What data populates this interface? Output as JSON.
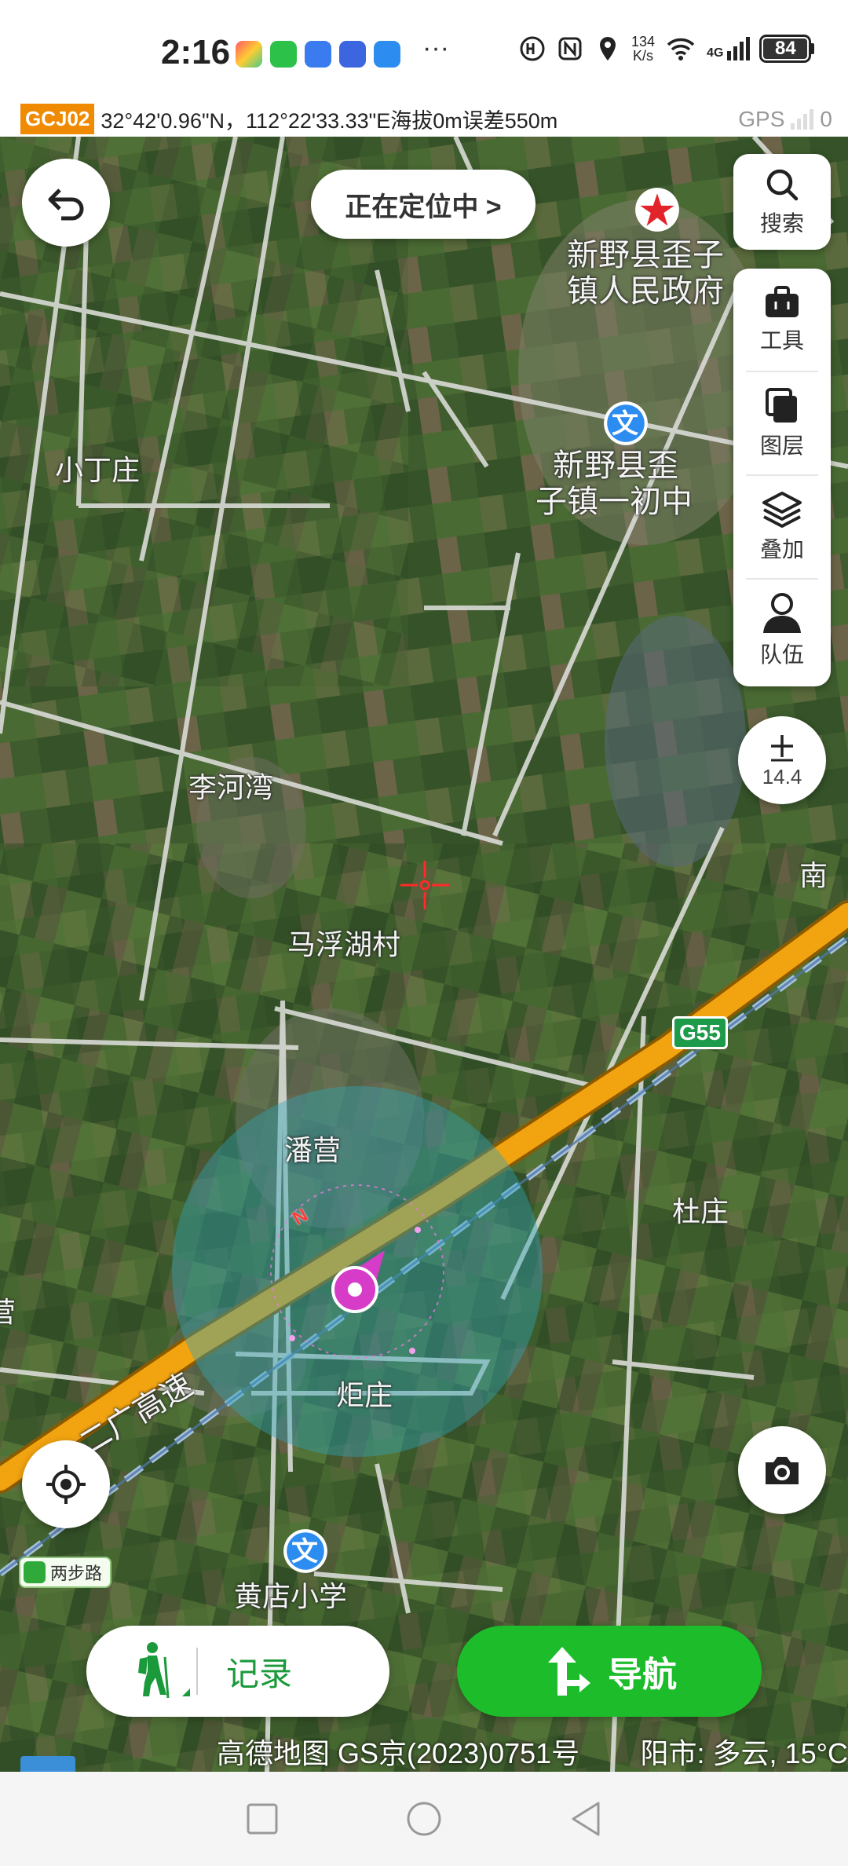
{
  "status_bar": {
    "time": "2:16",
    "more": "···",
    "net_speed_value": "134",
    "net_speed_unit": "K/s",
    "network": "4G",
    "battery": "84"
  },
  "coord_bar": {
    "crs": "GCJ02",
    "coords": "32°42'0.96\"N，112°22'33.33\"E海拔0m误差550m",
    "gps_label": "GPS",
    "gps_count": "0"
  },
  "map": {
    "labels": {
      "gov": "新野县歪子镇人民政府",
      "gov_line1": "新野县歪子",
      "gov_line2": "镇人民政府",
      "school1_line1": "新野县歪",
      "school1_line2": "子镇一初中",
      "xiaodingzhuang": "小丁庄",
      "liheiwan": "李河湾",
      "mahuhucun": "马浮湖村",
      "panying": "潘营",
      "duzhuang": "杜庄",
      "juzhuang": "炬庄",
      "huangdian": "黄店小学",
      "erguang": "二广高速",
      "nan": "南",
      "ying_edge": "营",
      "g55": "G55",
      "compass_n": "N",
      "wen": "文"
    }
  },
  "controls": {
    "back": "",
    "locating": "正在定位中 >",
    "search": "搜索",
    "tools": "工具",
    "layers": "图层",
    "overlay": "叠加",
    "team": "队伍",
    "zoom_plus": "+",
    "zoom_level": "14.4",
    "scale_label": "两步路",
    "record": "记录",
    "navigate": "导航"
  },
  "footer": {
    "copyright": "高德地图 GS京(2023)0751号",
    "weather": "阳市: 多云, 15°C"
  },
  "colors": {
    "accent_green": "#1cbc2a",
    "crs_orange": "#f08a00",
    "highway": "#f0a010",
    "location_marker": "#d63cc8"
  }
}
